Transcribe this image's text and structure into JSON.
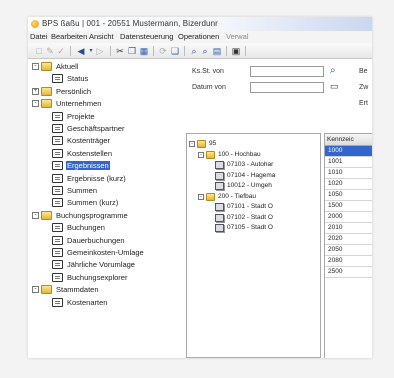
{
  "window": {
    "title": "BPS ßaßu | 001 - 20551 Mustermann, Bizerdunr"
  },
  "menu": [
    "Datei",
    "Bearbeiten",
    "Ansicht",
    "Datensteuerung",
    "Operationen",
    "Verwal"
  ],
  "nav_tree": [
    {
      "label": "Aktuell",
      "level": 0,
      "type": "folder",
      "expander": "-"
    },
    {
      "label": "Status",
      "level": 1,
      "type": "doc"
    },
    {
      "label": "Persönlich",
      "level": 0,
      "type": "folder",
      "expander": "+"
    },
    {
      "label": "Unternehmen",
      "level": 0,
      "type": "folder",
      "expander": "-"
    },
    {
      "label": "Projekte",
      "level": 1,
      "type": "doc"
    },
    {
      "label": "Geschäftspartner",
      "level": 1,
      "type": "doc"
    },
    {
      "label": "Kostenträger",
      "level": 1,
      "type": "doc"
    },
    {
      "label": "Kostenstellen",
      "level": 1,
      "type": "doc"
    },
    {
      "label": "Ergebnissen",
      "level": 1,
      "type": "doc",
      "selected": true
    },
    {
      "label": "Ergebnisse (kurz)",
      "level": 1,
      "type": "doc"
    },
    {
      "label": "Summen",
      "level": 1,
      "type": "doc"
    },
    {
      "label": "Summen (kurz)",
      "level": 1,
      "type": "doc"
    },
    {
      "label": "Buchungsprogramme",
      "level": 0,
      "type": "folder",
      "expander": "-"
    },
    {
      "label": "Buchungen",
      "level": 1,
      "type": "doc"
    },
    {
      "label": "Dauerbuchungen",
      "level": 1,
      "type": "doc"
    },
    {
      "label": "Gemeinkosten-Umlage",
      "level": 1,
      "type": "doc"
    },
    {
      "label": "Jährliche Vorumlage",
      "level": 1,
      "type": "doc"
    },
    {
      "label": "Buchungsexplorer",
      "level": 1,
      "type": "doc"
    },
    {
      "label": "Stammdaten",
      "level": 0,
      "type": "folder",
      "expander": "-"
    },
    {
      "label": "Kostenarten",
      "level": 1,
      "type": "doc"
    }
  ],
  "form": {
    "kst_label": "Ks.St. von",
    "kst_value": "",
    "datum_label": "Datum von",
    "datum_value": "",
    "right_labels": [
      "Be",
      "Zw",
      "Ert"
    ]
  },
  "project_tree": [
    {
      "label": "95",
      "level": 0,
      "type": "folder",
      "expander": "-"
    },
    {
      "label": "100 - Hochbau",
      "level": 1,
      "type": "folder",
      "expander": "-"
    },
    {
      "label": "07103 - Autohar",
      "level": 2,
      "type": "multi"
    },
    {
      "label": "07104 - Hagema",
      "level": 2,
      "type": "multi"
    },
    {
      "label": "10012 - Umgeh",
      "level": 2,
      "type": "multi"
    },
    {
      "label": "200 - Tiefbau",
      "level": 1,
      "type": "folder",
      "expander": "-"
    },
    {
      "label": "07101 - Stadt O",
      "level": 2,
      "type": "multi"
    },
    {
      "label": "07102 - Stadt O",
      "level": 2,
      "type": "multi"
    },
    {
      "label": "07105 - Stadt O",
      "level": 2,
      "type": "multi"
    }
  ],
  "grid": {
    "header": "Kennzeic",
    "rows": [
      "1000",
      "1001",
      "1010",
      "1020",
      "1050",
      "1500",
      "2000",
      "2010",
      "2020",
      "2050",
      "2080",
      "2500"
    ],
    "selected_index": 0
  }
}
